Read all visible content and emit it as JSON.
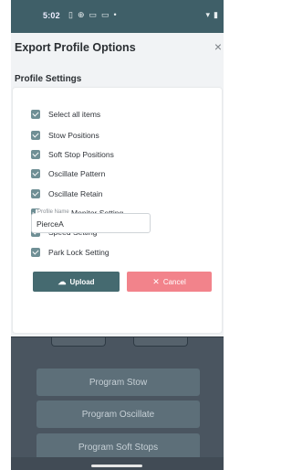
{
  "status_bar": {
    "time": "5:02",
    "icons": [
      "sim-icon",
      "settings-icon",
      "window-icon",
      "screen-icon",
      "dot"
    ],
    "right_icons": [
      "wifi-icon",
      "battery-icon"
    ]
  },
  "dialog": {
    "title": "Export Profile Options",
    "close_label": "×",
    "section_title": "Profile Settings",
    "items": [
      {
        "label": "Select all items",
        "checked": true
      },
      {
        "label": "Stow Positions",
        "checked": true
      },
      {
        "label": "Soft Stop Positions",
        "checked": true
      },
      {
        "label": "Oscillate Pattern",
        "checked": true
      },
      {
        "label": "Oscillate Retain",
        "checked": true
      },
      {
        "label": "Inhibit Monitor Setting",
        "checked": true
      },
      {
        "label": "Speed Setting",
        "checked": true
      },
      {
        "label": "Park Lock Setting",
        "checked": true
      }
    ],
    "profile_name": {
      "label": "Profile Name",
      "value": "PierceA"
    },
    "upload_label": "Upload",
    "cancel_label": "Cancel"
  },
  "background": {
    "buttons": [
      "Program Stow",
      "Program Oscillate",
      "Program Soft Stops"
    ]
  },
  "colors": {
    "accent": "#456a70",
    "checkbox": "#6f8f95",
    "cancel": "#f2838b",
    "status_bar": "#3f5f68"
  }
}
